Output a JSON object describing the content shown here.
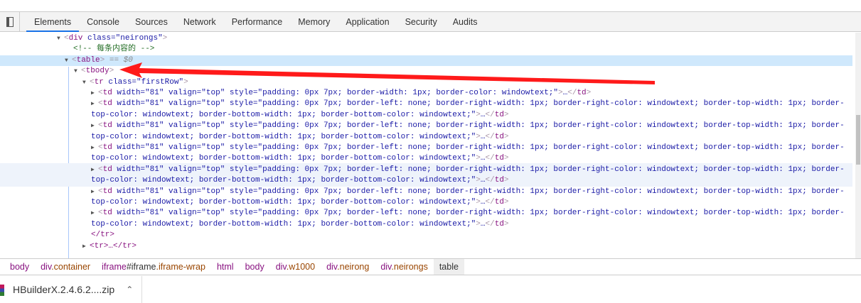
{
  "tabs": [
    "Elements",
    "Console",
    "Sources",
    "Network",
    "Performance",
    "Memory",
    "Application",
    "Security",
    "Audits"
  ],
  "active_tab": "Elements",
  "tree": {
    "div_line": {
      "tag": "div",
      "attr": "class",
      "val": "neirongs"
    },
    "comment": "<!-- 每条内容的 -->",
    "table": "table",
    "selected_marker": "== $0",
    "tbody": "tbody",
    "tr": {
      "tag": "tr",
      "attr": "class",
      "val": "firstRow"
    },
    "td_first": "<td width=\"81\" valign=\"top\" style=\"padding: 0px 7px; border-width: 1px; border-color: windowtext;\">…</td>",
    "td_line1": "<td width=\"81\" valign=\"top\" style=\"padding: 0px 7px; border-left: none; border-right-width: 1px; border-right-color: windowtext; border-top-width: 1px; border-",
    "td_line2": "top-color: windowtext; border-bottom-width: 1px; border-bottom-color: windowtext;\">…</td>",
    "td_wrapped_count": 6,
    "tr_close": "</tr>",
    "tr_collapsed": "<tr>…</tr>"
  },
  "breadcrumbs": [
    {
      "t": "body"
    },
    {
      "t": "div",
      "c": ".container"
    },
    {
      "t": "iframe",
      "id": "#iframe",
      "c": ".iframe-wrap"
    },
    {
      "t": "html"
    },
    {
      "t": "body"
    },
    {
      "t": "div",
      "c": ".w1000"
    },
    {
      "t": "div",
      "c": ".neirong"
    },
    {
      "t": "div",
      "c": ".neirongs"
    },
    {
      "t": "table",
      "current": true
    }
  ],
  "download": {
    "filename": "HBuilderX.2.4.6.2....zip"
  },
  "colors": {
    "accent": "#1a73e8",
    "selection": "#cfe8fc",
    "arrow": "#ff0000"
  }
}
